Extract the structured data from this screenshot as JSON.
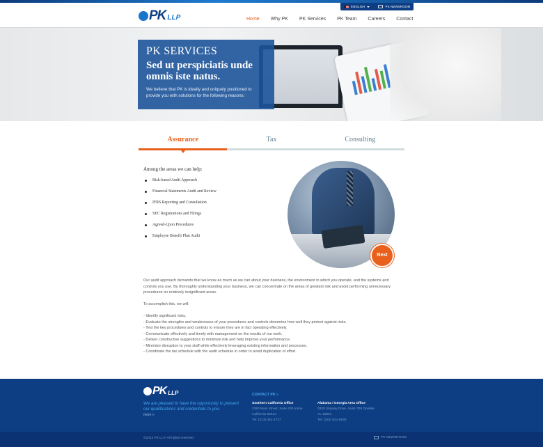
{
  "utility_bar": {
    "language": "ENGLISH",
    "newsroom": "PK NEWSROOM"
  },
  "brand": {
    "logo_text": "PK",
    "logo_suffix": "LLP",
    "primary_color": "#0d3e84",
    "accent_color": "#e8601c",
    "link_color": "#1776cc"
  },
  "nav": {
    "items": [
      {
        "label": "Home",
        "active": true
      },
      {
        "label": "Why PK",
        "active": false
      },
      {
        "label": "PK Services",
        "active": false
      },
      {
        "label": "PK Team",
        "active": false
      },
      {
        "label": "Careers",
        "active": false
      },
      {
        "label": "Contact",
        "active": false
      }
    ]
  },
  "hero": {
    "kicker": "PK SERVICES",
    "headline": "Sed ut perspiciatis unde omnis iste natus.",
    "intro": "We believe that PK is ideally and uniquely positioned to provide you with solutions for the following reasons:"
  },
  "tabs": [
    {
      "label": "Assurance",
      "active": true
    },
    {
      "label": "Tax",
      "active": false
    },
    {
      "label": "Consulting",
      "active": false
    }
  ],
  "content": {
    "areas_title": "Among the areas we can help:",
    "areas": [
      "Risk-based Audit Approach",
      "Financial Statements Audit and Review",
      "IFRS Reporting and Consultation",
      "SEC Registrations and Filings",
      "Agreed-Upon Procedures",
      "Employee Benefit Plan Audit"
    ],
    "next_label": "Next",
    "paragraph": "Our audit approach demands that we know as much as we can about your business, the environment in which you operate, and the systems and controls you use. By thoroughly understanding your business, we can concentrate on the areas of greatest risk and avoid performing unnecessary procedures on relatively insignificant areas.",
    "accomplish_intro": "To accomplish this, we will:",
    "steps": [
      "- Identify significant risks.",
      "- Evaluate the strengths and weaknesses of your procedures and controls determine how well they protect against risks.",
      "- Test the key procedures and controls to ensure they are in fact operating effectively.",
      "- Communicate effectively and timely with management on the results of our work.",
      "- Deliver constructive suggestions to minimize risk and help improve your performance.",
      "- Minimize disruption to your staff while effectively leveraging existing information and processes.",
      "- Coordinate the tax schedule with the audit schedule in order to avoid duplication of effort."
    ]
  },
  "footer": {
    "tagline": "We are pleased to have the opportunity to present our qualifications and credentials to you.",
    "more": "more »",
    "contact_heading": "CONTACT PK »",
    "offices": [
      {
        "name": "Southern California Office",
        "address1": "2390 Main Street, Suite 200 Irvine",
        "address2": "California 92614",
        "phone": "Tel: (213) 481-2727"
      },
      {
        "name": "Alabama / Georgia Area Office",
        "address1": "3320 Skyway Drive, Suite 709 Opelika",
        "address2": "AL 36804",
        "phone": "Tel: (334) 821-8826"
      }
    ],
    "copyright": "©2014 PK LLP. All rights reserved.",
    "newsroom": "PK NEWSROOM"
  }
}
